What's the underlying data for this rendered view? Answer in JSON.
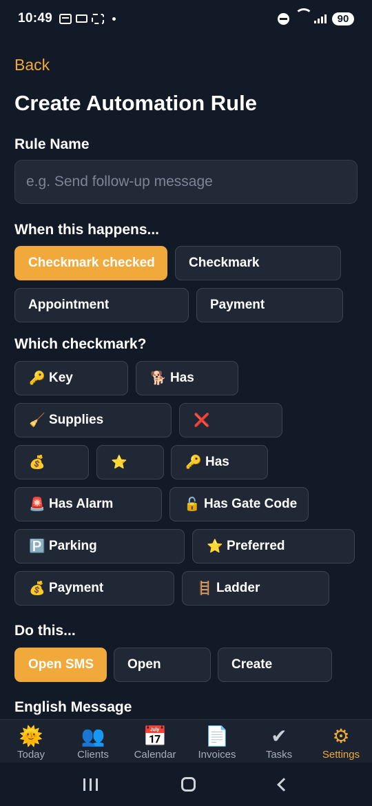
{
  "status_bar": {
    "time": "10:49",
    "battery": "90"
  },
  "header": {
    "back_label": "Back",
    "title": "Create Automation Rule"
  },
  "rule_name": {
    "label": "Rule Name",
    "placeholder": "e.g. Send follow-up message"
  },
  "trigger": {
    "label": "When this happens...",
    "options": [
      {
        "label": "Checkmark checked",
        "selected": true
      },
      {
        "label": "Checkmark",
        "selected": false
      },
      {
        "label": "Appointment",
        "selected": false
      },
      {
        "label": "Payment",
        "selected": false
      }
    ]
  },
  "checkmark": {
    "label": "Which checkmark?",
    "options": [
      {
        "emoji": "🔑",
        "label": "Key"
      },
      {
        "emoji": "🐕",
        "label": "Has"
      },
      {
        "emoji": "🧹",
        "label": "Supplies"
      },
      {
        "emoji": "❌",
        "label": ""
      },
      {
        "emoji": "💰",
        "label": ""
      },
      {
        "emoji": "⭐",
        "label": ""
      },
      {
        "emoji": "🔑",
        "label": "Has"
      },
      {
        "emoji": "🚨",
        "label": "Has Alarm"
      },
      {
        "emoji": "🔓",
        "label": "Has Gate Code"
      },
      {
        "emoji": "🅿️",
        "label": "Parking"
      },
      {
        "emoji": "⭐",
        "label": "Preferred"
      },
      {
        "emoji": "💰",
        "label": "Payment"
      },
      {
        "emoji": "🪜",
        "label": "Ladder"
      }
    ]
  },
  "action": {
    "label": "Do this...",
    "options": [
      {
        "label": "Open SMS",
        "selected": true
      },
      {
        "label": "Open",
        "selected": false
      },
      {
        "label": "Create",
        "selected": false
      }
    ]
  },
  "message": {
    "label": "English Message"
  },
  "tabbar": {
    "tabs": [
      {
        "icon": "🌞",
        "label": "Today",
        "active": false
      },
      {
        "icon": "👥",
        "label": "Clients",
        "active": false
      },
      {
        "icon": "📅",
        "label": "Calendar",
        "active": false
      },
      {
        "icon": "📄",
        "label": "Invoices",
        "active": false
      },
      {
        "icon": "✔",
        "label": "Tasks",
        "active": false
      },
      {
        "icon": "⚙",
        "label": "Settings",
        "active": true
      }
    ]
  },
  "colors": {
    "accent": "#f0a93a",
    "background": "#131a27",
    "chip": "#202836"
  }
}
